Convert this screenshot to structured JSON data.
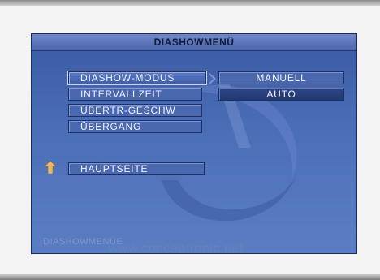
{
  "menu": {
    "title": "DIASHOWMENÜ",
    "items": [
      {
        "label": "DIASHOW-MODUS"
      },
      {
        "label": "INTERVALLZEIT"
      },
      {
        "label": "ÜBERTR-GESCHW"
      },
      {
        "label": "ÜBERGANG"
      }
    ],
    "home_label": "HAUPTSEITE",
    "submenu": [
      {
        "label": "MANUELL"
      },
      {
        "label": "AUTO"
      }
    ],
    "footer_label": "DIASHOWMENÜE",
    "watermark": "www.conceptronic.net"
  },
  "colors": {
    "menu_blue": "#4b6fb7",
    "highlight": "#2d4688"
  },
  "icons": {
    "selection_arrow": "arrow-right-icon",
    "home": "up-arrow-icon"
  }
}
